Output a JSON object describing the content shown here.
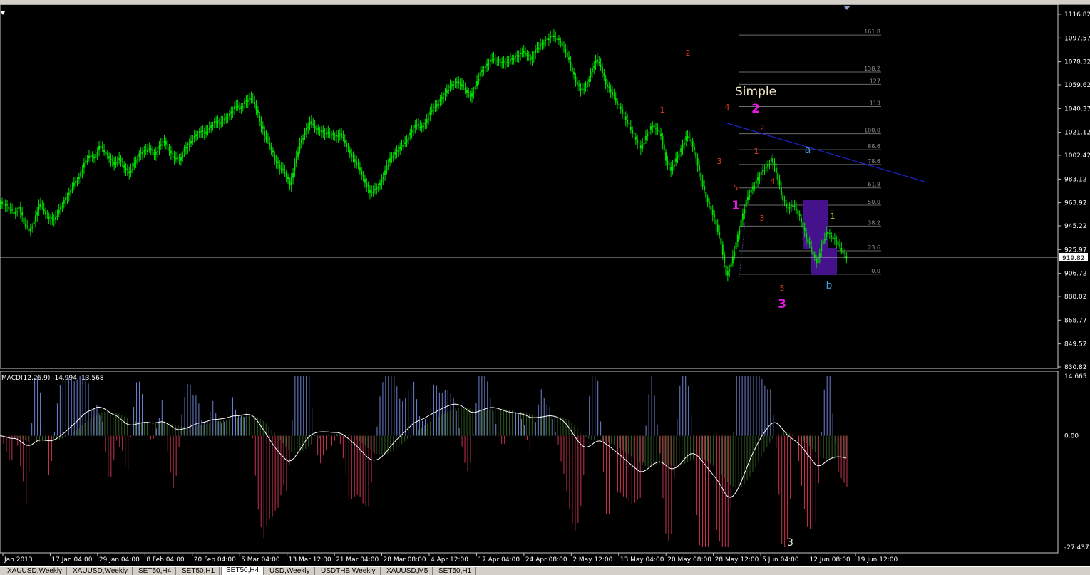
{
  "colors": {
    "background": "#000000",
    "candle": "#00e000",
    "price_axis_text": "#ffffff",
    "grid_line": "#808080",
    "trendline": "#1e22c8",
    "fib": "#6c6c6c",
    "wave_orange": "#e63c1e",
    "wave_magenta": "#e619e6",
    "wave_blue": "#3ca0e6",
    "wave_yellow": "#b4d21e",
    "box": "#46128c",
    "macd_blue": "#6e82d2",
    "macd_red": "#c83250",
    "macd_signal": "#325a23",
    "macd_line": "#ffffff"
  },
  "chart_data": [
    {
      "type": "line",
      "title": "",
      "x_dates": [
        "Jan 2013",
        "17 Jan 04:00",
        "29 Jan 04:00",
        "8 Feb 04:00",
        "20 Feb 04:00",
        "5 Mar 04:00",
        "13 Mar 12:00",
        "21 Mar 04:00",
        "28 Mar 08:00",
        "4 Apr 12:00",
        "17 Apr 04:00",
        "24 Apr 08:00",
        "2 May 12:00",
        "13 May 04:00",
        "20 May 08:00",
        "28 May 12:00",
        "5 Jun 04:00",
        "12 Jun 08:00",
        "19 Jun 12:00"
      ],
      "y_ticks": [
        "1116.82",
        "1097.57",
        "1078.32",
        "1059.62",
        "1040.37",
        "1021.12",
        "1002.42",
        "983.12",
        "963.92",
        "945.22",
        "925.97",
        "906.72",
        "888.02",
        "868.77",
        "849.52",
        "830.82"
      ],
      "ylim": [
        830.82,
        1116.82
      ],
      "current_price": "919.82",
      "series": [
        {
          "values": [
            963,
            959,
            955,
            961,
            947,
            941,
            949,
            963,
            957,
            951,
            950,
            958,
            966,
            972,
            980,
            985,
            996,
            1002,
            1000,
            1010,
            1005,
            1000,
            995,
            1000,
            992,
            988,
            996,
            1004,
            1006,
            1008,
            1003,
            1010,
            1014,
            1006,
            1000,
            998,
            1008,
            1012,
            1018,
            1022,
            1020,
            1025,
            1030,
            1028,
            1032,
            1036,
            1042,
            1040,
            1046,
            1049,
            1044,
            1030,
            1018,
            1010,
            999,
            992,
            988,
            978,
            996,
            1012,
            1022,
            1030,
            1024,
            1022,
            1020,
            1019,
            1018,
            1020,
            1012,
            1004,
            997,
            990,
            980,
            972,
            975,
            980,
            990,
            1000,
            1005,
            1009,
            1013,
            1021,
            1027,
            1025,
            1029,
            1038,
            1042,
            1048,
            1053,
            1059,
            1062,
            1060,
            1055,
            1050,
            1059,
            1070,
            1075,
            1080,
            1079,
            1078,
            1077,
            1080,
            1083,
            1085,
            1085,
            1080,
            1088,
            1092,
            1096,
            1099,
            1097,
            1094,
            1086,
            1074,
            1062,
            1055,
            1058,
            1070,
            1080,
            1074,
            1060,
            1054,
            1046,
            1040,
            1031,
            1023,
            1015,
            1008,
            1018,
            1026,
            1024,
            1018,
            998,
            990,
            1000,
            1008,
            1018,
            1014,
            1000,
            982,
            968,
            958,
            946,
            930,
            905,
            915,
            932,
            950,
            966,
            975,
            982,
            989,
            993,
            1000,
            988,
            970,
            960,
            962,
            958,
            948,
            935,
            925,
            915,
            930,
            940,
            936,
            932,
            925,
            919
          ]
        }
      ]
    },
    {
      "type": "bar",
      "title": "MACD(12,26,9) -14.994 -13.568",
      "y_ticks": [
        "14.665",
        "0.00",
        "-27.437"
      ],
      "ylim": [
        -27.437,
        14.665
      ],
      "series": [
        {
          "name": "MACD",
          "values": [
            -14.994
          ]
        },
        {
          "name": "Signal",
          "values": [
            -13.568
          ]
        }
      ]
    }
  ],
  "annotations": {
    "simple_label": "Simple",
    "fib_levels": [
      "161.8",
      "138.2",
      "127",
      "113",
      "100.0",
      "88.6",
      "78.6",
      "61.8",
      "50.0",
      "38.2",
      "23.6",
      "0.0"
    ],
    "fib_prices": [
      1100,
      1070,
      1060,
      1042,
      1020,
      1007,
      995,
      976,
      962,
      945,
      925,
      906
    ],
    "waves": [
      {
        "t": "1",
        "c": "orange",
        "x": 929,
        "y": 152
      },
      {
        "t": "2",
        "c": "orange",
        "x": 965,
        "y": 72
      },
      {
        "t": "3",
        "c": "orange",
        "x": 1009,
        "y": 224
      },
      {
        "t": "4",
        "c": "orange",
        "x": 1020,
        "y": 148
      },
      {
        "t": "5",
        "c": "orange",
        "x": 1032,
        "y": 261
      },
      {
        "t": "1",
        "c": "magenta",
        "x": 1032,
        "y": 288
      },
      {
        "t": "2",
        "c": "orange",
        "x": 1069,
        "y": 177
      },
      {
        "t": "1",
        "c": "orange",
        "x": 1061,
        "y": 210
      },
      {
        "t": "4",
        "c": "orange",
        "x": 1084,
        "y": 252
      },
      {
        "t": "3",
        "c": "orange",
        "x": 1069,
        "y": 304
      },
      {
        "t": "5",
        "c": "orange",
        "x": 1097,
        "y": 402
      },
      {
        "t": "3",
        "c": "magenta",
        "x": 1097,
        "y": 426
      },
      {
        "t": "2",
        "c": "magenta",
        "x": 1060,
        "y": 152
      },
      {
        "t": "a",
        "c": "blue",
        "x": 1133,
        "y": 209
      },
      {
        "t": "b",
        "c": "blue",
        "x": 1163,
        "y": 399
      },
      {
        "t": "1",
        "c": "yellow",
        "x": 1168,
        "y": 301
      }
    ],
    "macd_wave_label": "3"
  },
  "tabs": [
    {
      "label": "XAUUSD,Weekly",
      "active": false
    },
    {
      "label": "XAUUSD,Weekly",
      "active": false
    },
    {
      "label": "SET50,H4",
      "active": false
    },
    {
      "label": "SET50,H1",
      "active": false
    },
    {
      "label": "SET50,H4",
      "active": true
    },
    {
      "label": "USD,Weekly",
      "active": false
    },
    {
      "label": "USDTHB,Weekly",
      "active": false
    },
    {
      "label": "XAUUSD,M5",
      "active": false
    },
    {
      "label": "SET50,H1",
      "active": false
    }
  ]
}
